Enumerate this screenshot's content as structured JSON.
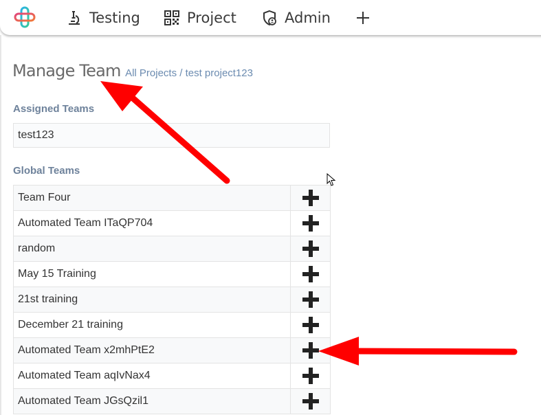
{
  "nav": {
    "testing_label": "Testing",
    "project_label": "Project",
    "admin_label": "Admin"
  },
  "header": {
    "title": "Manage Team",
    "breadcrumb": "All Projects / test project123"
  },
  "assigned": {
    "label": "Assigned Teams",
    "teams": [
      "test123"
    ]
  },
  "global": {
    "label": "Global Teams",
    "teams": [
      "Team Four",
      "Automated Team ITaQP704",
      "random",
      "May 15 Training",
      "21st training",
      "December 21 training",
      "Automated Team x2mhPtE2",
      "Automated Team aqIvNax4",
      "Automated Team JGsQzil1"
    ]
  },
  "colors": {
    "accent_link": "#6b8bb0",
    "section_label": "#6e829b",
    "annotation_arrow": "#ff0000"
  }
}
